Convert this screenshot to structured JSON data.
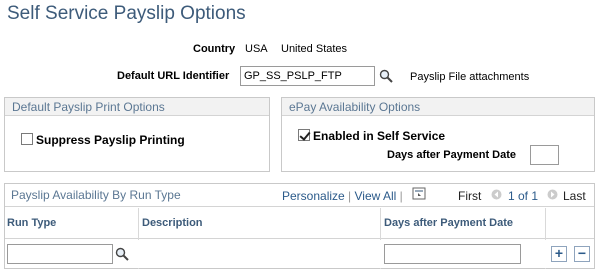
{
  "page": {
    "title": "Self Service Payslip Options"
  },
  "fields": {
    "country_label": "Country",
    "country_code": "USA",
    "country_name": "United States",
    "default_url_label": "Default URL Identifier",
    "default_url_value": "GP_SS_PSLP_FTP",
    "default_url_desc": "Payslip File attachments"
  },
  "print_options": {
    "header": "Default Payslip Print Options",
    "suppress_label": "Suppress Payslip Printing",
    "suppress_checked": false
  },
  "epay": {
    "header": "ePay Availability Options",
    "enabled_label": "Enabled in Self Service",
    "enabled_checked": true,
    "days_label": "Days after Payment Date",
    "days_value": ""
  },
  "grid": {
    "title": "Payslip Availability By Run Type",
    "personalize": "Personalize",
    "view_all": "View All",
    "first": "First",
    "range": "1 of 1",
    "last": "Last",
    "columns": [
      "Run Type",
      "Description",
      "Days after Payment Date"
    ],
    "rows": [
      {
        "run_type": "",
        "description": "",
        "days": ""
      }
    ],
    "add_symbol": "+",
    "remove_symbol": "−"
  },
  "icons": {
    "lookup": "magnifier-icon",
    "download": "download-icon",
    "first_arrow": "first-arrow-icon",
    "prev_arrow": "prev-arrow-icon",
    "next_arrow": "next-arrow-icon"
  },
  "colors": {
    "title": "#3d5b7a",
    "section_header": "#5b7793",
    "link": "#2b5a8a"
  }
}
